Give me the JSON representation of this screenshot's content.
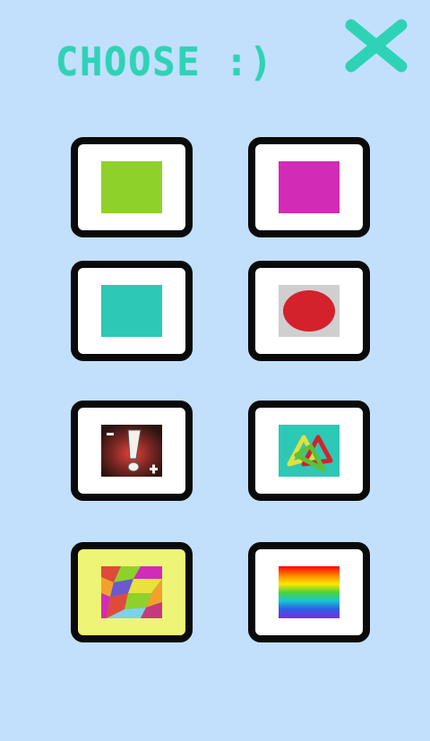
{
  "header": {
    "title": "CHOOSE :)",
    "close_icon": "close-x-icon"
  },
  "colors": {
    "background": "#c2e0fb",
    "accent": "#2ed3b7",
    "tile_border": "#0a0a0a",
    "tile_fill": "#ffffff"
  },
  "options": [
    {
      "name": "green",
      "type": "solid-color",
      "color": "#8fd12b"
    },
    {
      "name": "magenta",
      "type": "solid-color",
      "color": "#d22cb7"
    },
    {
      "name": "teal",
      "type": "solid-color",
      "color": "#2ec8b6"
    },
    {
      "name": "red-circle",
      "type": "pattern",
      "color": "#d3222b"
    },
    {
      "name": "exclamation-plus-minus",
      "type": "pattern",
      "plus": "+",
      "minus": "-"
    },
    {
      "name": "triangles",
      "type": "pattern",
      "color": "#2ec8b6"
    },
    {
      "name": "mosaic",
      "type": "pattern",
      "color": "#eef576"
    },
    {
      "name": "rainbow",
      "type": "gradient",
      "color": "#ff0000"
    }
  ]
}
